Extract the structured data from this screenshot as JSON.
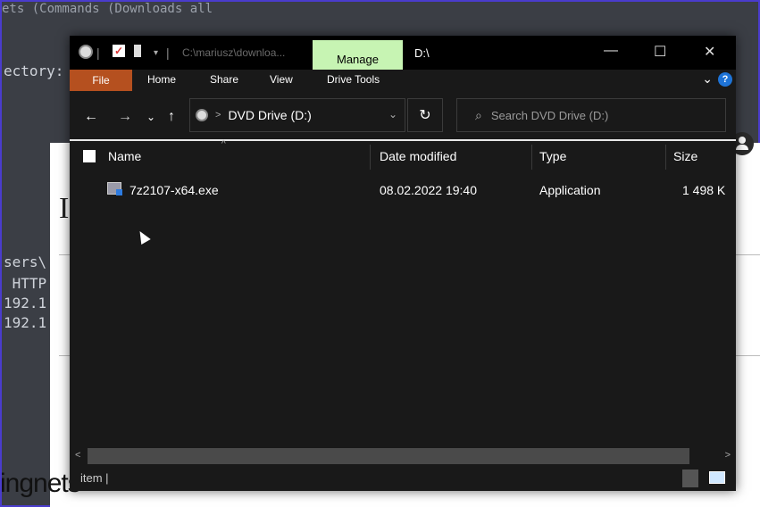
{
  "terminal": {
    "top_line": "ets (Commands (Downloads   all",
    "lines": [
      "ectory:",
      "sers\\",
      " HTTP",
      "192.1",
      "192.1"
    ],
    "bottom_text": "ingnets"
  },
  "explorer": {
    "title_path": "C:\\mariusz\\downloa...",
    "manage_tab": "Manage",
    "drive_title": "D:\\",
    "window_buttons": {
      "minimize": "—",
      "maximize": "☐",
      "close": "✕"
    },
    "ribbon_tabs": {
      "file": "File",
      "home": "Home",
      "share": "Share",
      "view": "View",
      "drive_tools": "Drive Tools"
    },
    "ribbon_collapse": "⌄",
    "help": "?",
    "nav": {
      "back": "←",
      "forward": "→",
      "recent": "⌄",
      "up": "↑",
      "crumb_sep": ">"
    },
    "address": "DVD Drive (D:)",
    "address_chevron": "⌄",
    "refresh": "↻",
    "search_placeholder": "Search DVD Drive (D:)",
    "columns": {
      "name": "Name",
      "date": "Date modified",
      "type": "Type",
      "size": "Size"
    },
    "files": [
      {
        "name": "7z2107-x64.exe",
        "date": "08.02.2022 19:40",
        "type": "Application",
        "size": "1 498 K"
      }
    ],
    "status": "item  |",
    "scroll_left": "<",
    "scroll_right": ">"
  },
  "colors": {
    "manage_tab": "#c7f4b3",
    "file_tab": "#b5501f",
    "explorer_bg": "#191919",
    "terminal_border": "#4a3ccc"
  }
}
